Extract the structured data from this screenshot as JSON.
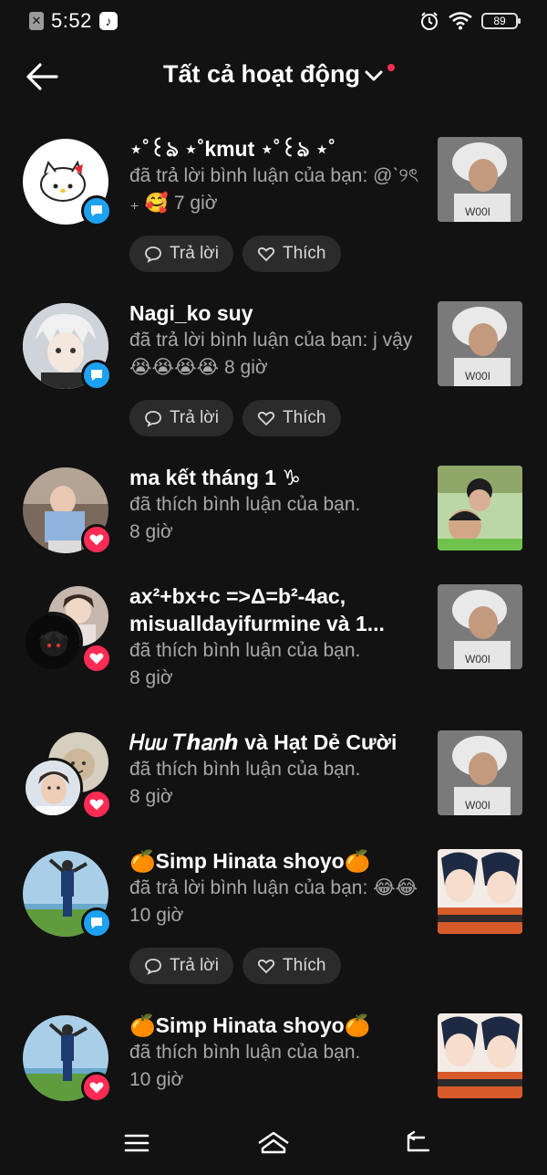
{
  "status_bar": {
    "time": "5:52",
    "battery": "89",
    "left_icons": [
      "x-box-icon",
      "tiktok-icon"
    ],
    "right_icons": [
      "alarm-icon",
      "wifi-icon",
      "battery-icon"
    ]
  },
  "header": {
    "title": "Tất cả hoạt động",
    "back_icon": "arrow-left-icon",
    "dropdown_icon": "chevron-down-icon",
    "dot_color": "#fe2c55"
  },
  "actions": {
    "reply_label": "Trả lời",
    "like_label": "Thích"
  },
  "notifications": [
    {
      "name": "⋆˚꒰ঌ ⋆˚kmut ⋆˚꒰ঌ ⋆˚",
      "text": "đã trả lời bình luận của bạn: @ˋ୨ৎ ₊ 🥰",
      "time": "7 giờ",
      "type": "comment"
    },
    {
      "name": "Nagi_ko suy",
      "text": "đã trả lời bình luận của bạn: j vậy😭😭😭😭",
      "time": "8 giờ",
      "type": "comment"
    },
    {
      "name": "ma kết tháng 1 ♑",
      "text": "đã thích bình luận của bạn.",
      "time": "8 giờ",
      "type": "like"
    },
    {
      "name": "ax²+bx+c =>Δ=b²-4ac, misualldayifurmine và 1...",
      "text": "đã thích bình luận của bạn.",
      "time": "8 giờ",
      "type": "like"
    },
    {
      "name": "𝐻𝑢𝑢 𝑇ℎ𝑎𝑛ℎ󠀠 và Hạt Dẻ Cười",
      "text": "đã thích bình luận của bạn.",
      "time": "8 giờ",
      "type": "like"
    },
    {
      "name": "🍊Simp Hinata shoyo🍊",
      "text": "đã trả lời bình luận của bạn: 😂😂",
      "time": "10 giờ",
      "type": "comment"
    },
    {
      "name": "🍊Simp Hinata shoyo🍊",
      "text": "đã thích bình luận của bạn.",
      "time": "10 giờ",
      "type": "like"
    }
  ],
  "navbar": {
    "icons": [
      "menu-icon",
      "home-icon",
      "back-icon"
    ]
  }
}
